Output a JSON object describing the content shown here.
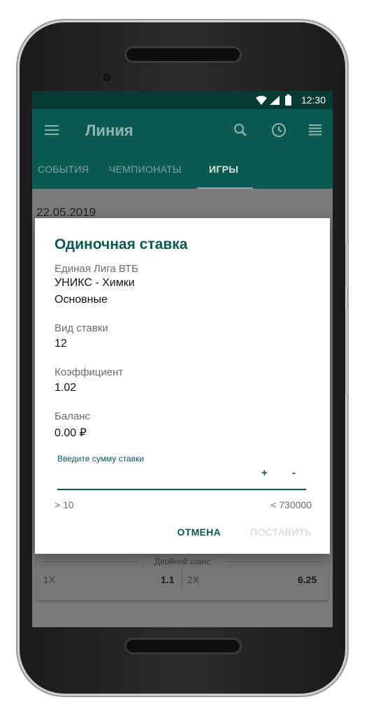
{
  "status_bar": {
    "time": "12:30"
  },
  "app_bar": {
    "title": "Линия"
  },
  "tabs": [
    {
      "label": "СОБЫТИЯ"
    },
    {
      "label": "ЧЕМПИОНАТЫ"
    },
    {
      "label": "ИГРЫ",
      "active": true
    }
  ],
  "content": {
    "date": "22.05.2019",
    "card": {
      "title": "Двойной шанс",
      "odds": [
        {
          "label": "1X",
          "value": "1.1"
        },
        {
          "label": "2X",
          "value": "6.25"
        }
      ]
    }
  },
  "dialog": {
    "title": "Одиночная ставка",
    "league": "Единая Лига ВТБ",
    "match": "УНИКС - Химки",
    "market": "Основные",
    "bet_type_label": "Вид ставки",
    "bet_type_value": "12",
    "coef_label": "Коэффициент",
    "coef_value": "1.02",
    "balance_label": "Баланс",
    "balance_value": "0.00 ₽",
    "input_label": "Введите сумму ставки",
    "input_value": "",
    "plus": "+",
    "minus": "-",
    "min_limit": "> 10",
    "max_limit": "< 730000",
    "cancel": "ОТМЕНА",
    "submit": "ПОСТАВИТЬ"
  },
  "colors": {
    "primary": "#0a5a52",
    "status_bar": "#063b35",
    "disabled": "#cfcfcf"
  }
}
